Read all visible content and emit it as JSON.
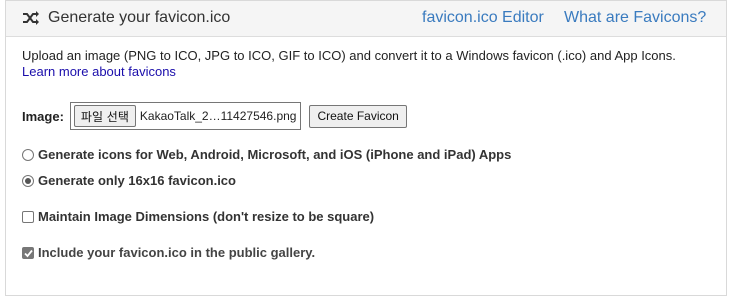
{
  "header": {
    "title": "Generate your favicon.ico",
    "link_editor": "favicon.ico Editor",
    "link_what": "What are Favicons?"
  },
  "description": {
    "text": "Upload an image (PNG to ICO, JPG to ICO, GIF to ICO) and convert it to a Windows favicon (.ico) and App Icons.",
    "learn_more": "Learn more about favicons"
  },
  "upload": {
    "label": "Image:",
    "file_button": "파일 선택",
    "file_name": "KakaoTalk_2…11427546.png",
    "create_button": "Create Favicon"
  },
  "options": {
    "generate_web": "Generate icons for Web, Android, Microsoft, and iOS (iPhone and iPad) Apps",
    "generate_web_selected": false,
    "generate_16": "Generate only 16x16 favicon.ico",
    "generate_16_selected": true,
    "maintain_dimensions": "Maintain Image Dimensions (don't resize to be square)",
    "maintain_dimensions_checked": false,
    "include_gallery": "Include your favicon.ico in the public gallery.",
    "include_gallery_checked": true
  },
  "colors": {
    "link": "#3a7bbf",
    "description_link": "#1a0dab",
    "header_bg": "#f5f5f5"
  },
  "icons": {
    "header_icon": "shuffle-icon"
  }
}
